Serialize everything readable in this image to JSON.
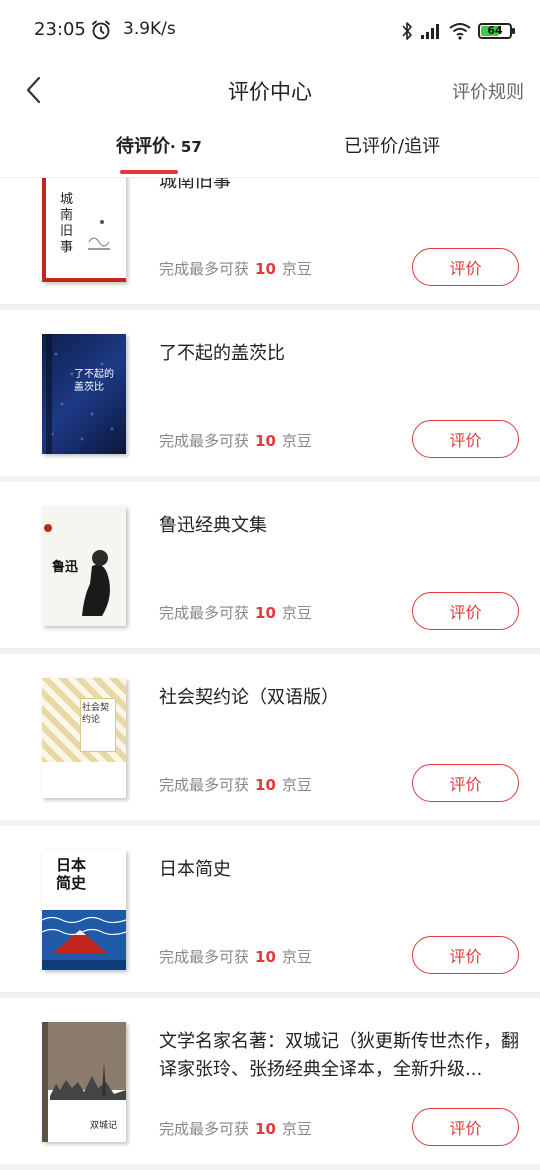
{
  "status_bar": {
    "time": "23:05",
    "net_speed": "3.9K/s",
    "battery": "64",
    "battery_level": 0.64
  },
  "nav": {
    "title": "评价中心",
    "rule_link": "评价规则"
  },
  "tabs": [
    {
      "label": "待评价",
      "count": "· 57",
      "active": true
    },
    {
      "label": "已评价/追评",
      "active": false
    }
  ],
  "accent_color": "#e4393c",
  "items": [
    {
      "title": "城南旧事",
      "reward_prefix": "完成最多可获",
      "reward_amount": "10",
      "reward_unit": "京豆",
      "button": "评价",
      "cover_text": "城南旧事"
    },
    {
      "title": "了不起的盖茨比",
      "reward_prefix": "完成最多可获",
      "reward_amount": "10",
      "reward_unit": "京豆",
      "button": "评价",
      "cover_text": "了不起的盖茨比"
    },
    {
      "title": "鲁迅经典文集",
      "reward_prefix": "完成最多可获",
      "reward_amount": "10",
      "reward_unit": "京豆",
      "button": "评价",
      "cover_text": "鲁迅"
    },
    {
      "title": "社会契约论（双语版）",
      "reward_prefix": "完成最多可获",
      "reward_amount": "10",
      "reward_unit": "京豆",
      "button": "评价",
      "cover_text": "社会契约论"
    },
    {
      "title": "日本简史",
      "reward_prefix": "完成最多可获",
      "reward_amount": "10",
      "reward_unit": "京豆",
      "button": "评价",
      "cover_text": "日本简史"
    },
    {
      "title": "文学名家名著：双城记（狄更斯传世杰作，翻译家张玲、张扬经典全译本，全新升级...",
      "reward_prefix": "完成最多可获",
      "reward_amount": "10",
      "reward_unit": "京豆",
      "button": "评价",
      "cover_text": "双城记"
    }
  ]
}
